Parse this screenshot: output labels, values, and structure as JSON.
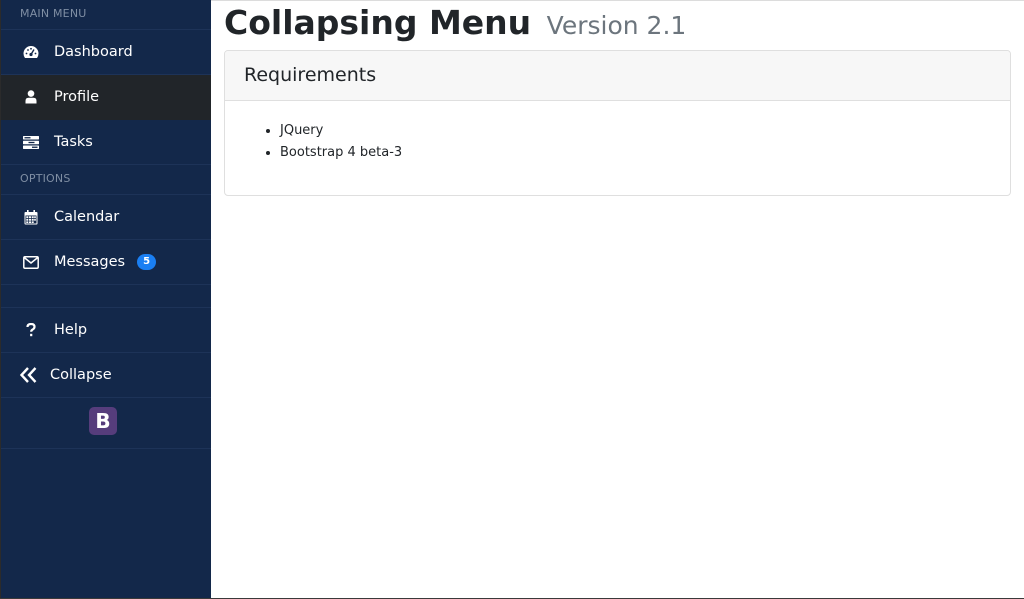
{
  "sidebar": {
    "section_main": "MAIN MENU",
    "section_options": "OPTIONS",
    "items": [
      {
        "label": "Dashboard",
        "icon": "dashboard-icon"
      },
      {
        "label": "Profile",
        "icon": "user-icon",
        "active": true
      },
      {
        "label": "Tasks",
        "icon": "tasks-icon"
      },
      {
        "label": "Calendar",
        "icon": "calendar-icon"
      },
      {
        "label": "Messages",
        "icon": "envelope-icon",
        "badge": "5"
      },
      {
        "label": "Help",
        "icon": "question-icon"
      },
      {
        "label": "Collapse",
        "icon": "double-chevron-left-icon"
      }
    ],
    "logo_letter": "B"
  },
  "main": {
    "title": "Collapsing Menu",
    "version": "Version 2.1",
    "card": {
      "header": "Requirements",
      "items": [
        "JQuery",
        "Bootstrap 4 beta-3"
      ]
    }
  },
  "colors": {
    "sidebar_bg": "#13284a",
    "active_bg": "#212529",
    "badge_bg": "#1a7ff3",
    "logo_bg": "#563d7c"
  }
}
